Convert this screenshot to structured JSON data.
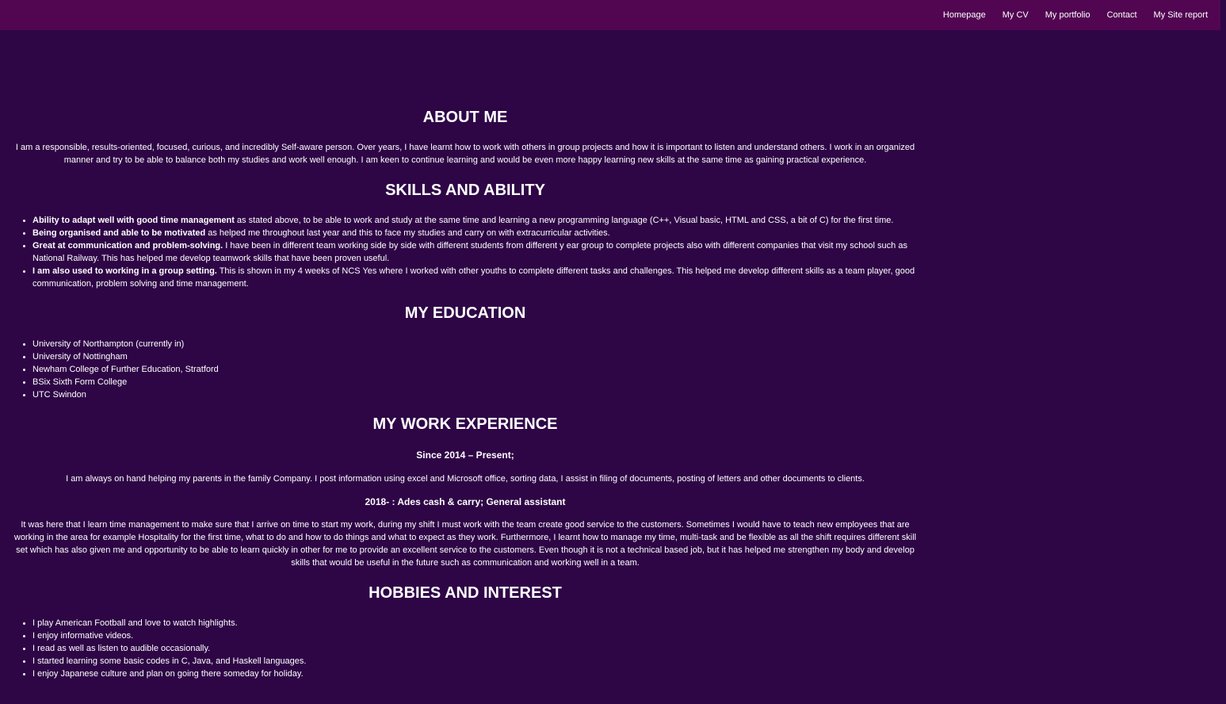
{
  "nav": {
    "items": [
      "Homepage",
      "My CV",
      "My portfolio",
      "Contact",
      "My Site report"
    ]
  },
  "about": {
    "heading": "ABOUT ME",
    "text": "I am a responsible, results-oriented, focused, curious, and incredibly Self-aware person. Over years, I have learnt how to work with others in group projects and how it is important to listen and understand others. I work in an organized manner and try to be able to balance both my studies and work well enough. I am keen to continue learning and would be even more happy learning new skills at the same time as gaining practical experience."
  },
  "skills": {
    "heading": "SKILLS AND ABILITY",
    "items": [
      {
        "bold": "Ability to adapt well with good time management",
        "text": " as stated above, to be able to work and study at the same time and learning a new programming language (C++, Visual basic, HTML and CSS, a bit of C) for the first time."
      },
      {
        "bold": "Being organised and able to be motivated",
        "text": " as helped me throughout last year and this to face my studies and carry on with extracurricular activities."
      },
      {
        "bold": "Great at communication and problem-solving.",
        "text": " I have been in different team working side by side with different students from different y ear group to complete projects also with different companies that visit my school such as National Railway. This has helped me develop teamwork skills that have been proven useful."
      },
      {
        "bold": "I am also used to working in a group setting.",
        "text": " This is shown in my 4 weeks of NCS Yes where I worked with other youths to complete different tasks and challenges. This helped me develop different skills as a team player, good communication, problem solving and time management."
      }
    ]
  },
  "education": {
    "heading": "MY EDUCATION",
    "items": [
      "University of Northampton (currently in)",
      "University of Nottingham",
      "Newham College of Further Education, Stratford",
      "BSix Sixth Form College",
      "UTC Swindon"
    ]
  },
  "work": {
    "heading": "MY WORK EXPERIENCE",
    "job1_title": "Since 2014 – Present;",
    "job1_text": "I am always on hand helping my parents in the family Company. I post information using excel and Microsoft office, sorting data, I assist in filing of documents, posting of letters and other documents to clients.",
    "job2_title": "2018- : Ades cash & carry; General assistant",
    "job2_text": "It was here that I learn time management to make sure that I arrive on time to start my work, during my shift I must work with the team create good service to the customers. Sometimes I would have to teach new employees that are working in the area for example Hospitality for the first time, what to do and how to do things and what to expect as they work. Furthermore, I learnt how to manage my time, multi-task and be flexible as all the shift requires different skill set which has also given me and opportunity to be able to learn quickly in other for me to provide an excellent service to the customers. Even though it is not a technical based job, but it has helped me strengthen my body and develop skills that would be useful in the future such as communication and working well in a team."
  },
  "hobbies": {
    "heading": "HOBBIES AND INTEREST",
    "items": [
      "I play American Football and love to watch highlights.",
      "I enjoy informative videos.",
      "I read as well as listen to audible occasionally.",
      "I started learning some basic codes in C, Java, and Haskell languages.",
      "I enjoy Japanese culture and plan on going there someday for holiday."
    ]
  },
  "colors": {
    "background": "#2e0646",
    "nav_background": "#520652",
    "text": "#ffffff"
  }
}
